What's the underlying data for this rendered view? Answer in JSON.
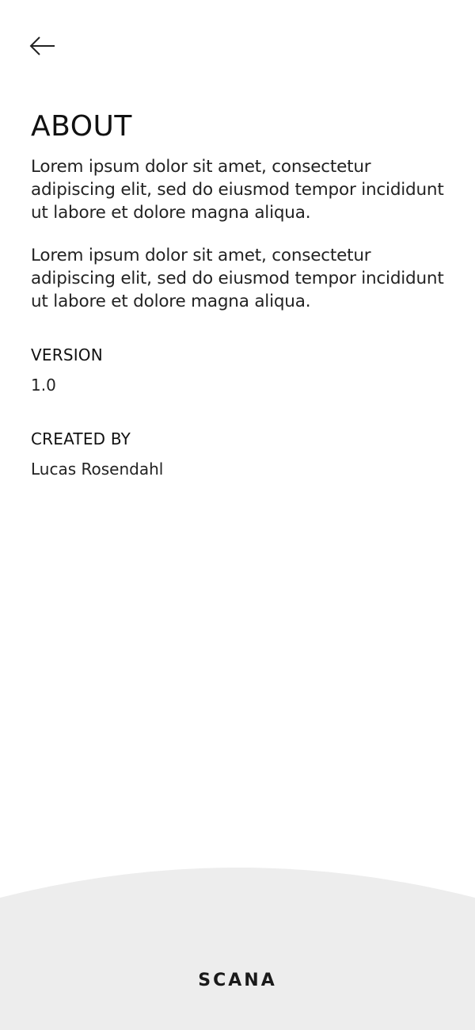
{
  "header": {
    "back_icon": "arrow-left-icon"
  },
  "about": {
    "title": "ABOUT",
    "paragraphs": [
      "Lorem ipsum dolor sit amet, consectetur adipiscing elit, sed do eiusmod tempor incididunt ut labore et dolore magna aliqua.",
      "Lorem ipsum dolor sit amet, consectetur adipiscing elit, sed do eiusmod tempor incididunt ut labore et dolore magna aliqua."
    ]
  },
  "version": {
    "label": "VERSION",
    "value": "1.0"
  },
  "created_by": {
    "label": "CREATED BY",
    "value": "Lucas Rosendahl"
  },
  "footer": {
    "brand": "SCANA",
    "background_color": "#ededed"
  },
  "colors": {
    "background": "#ffffff",
    "text": "#1a1a1a"
  }
}
